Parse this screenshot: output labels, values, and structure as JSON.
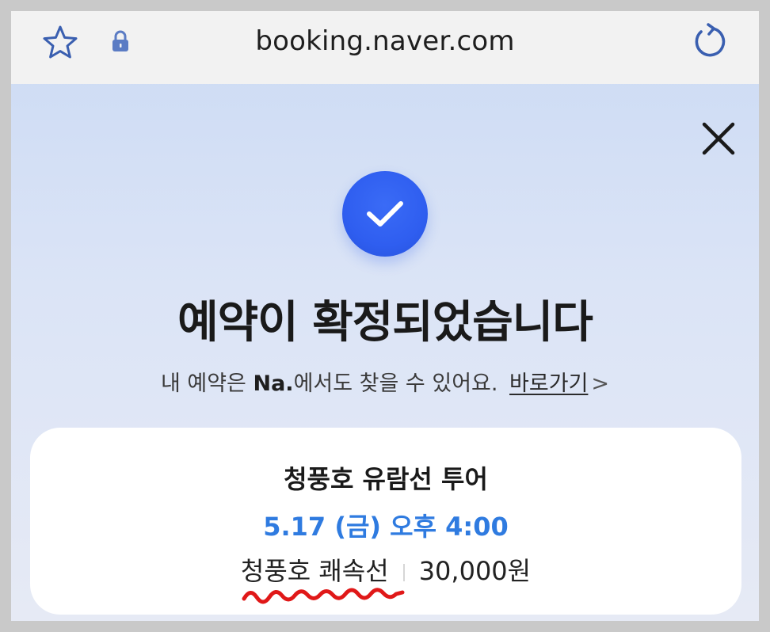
{
  "browser": {
    "url": "booking.naver.com",
    "icons": {
      "favorite": "star-icon",
      "secure": "lock-icon",
      "reload": "reload-icon"
    }
  },
  "page": {
    "close_icon": "close-icon",
    "status_icon": "check-icon",
    "title": "예약이 확정되었습니다",
    "subtitle_pre": "내 예약은 ",
    "subtitle_bold": "Na.",
    "subtitle_post": "에서도 찾을 수 있어요.",
    "shortcut_label": "바로가기",
    "chevron": ">"
  },
  "booking": {
    "name": "청풍호 유람선 투어",
    "datetime": "5.17 (금) 오후 4:00",
    "option": "청풍호 쾌속선",
    "price": "30,000원"
  },
  "colors": {
    "accent_blue": "#2f5ef0",
    "date_blue": "#2f7be0",
    "annotation_red": "#e01818",
    "browser_icon_blue": "#3a5fb0"
  }
}
